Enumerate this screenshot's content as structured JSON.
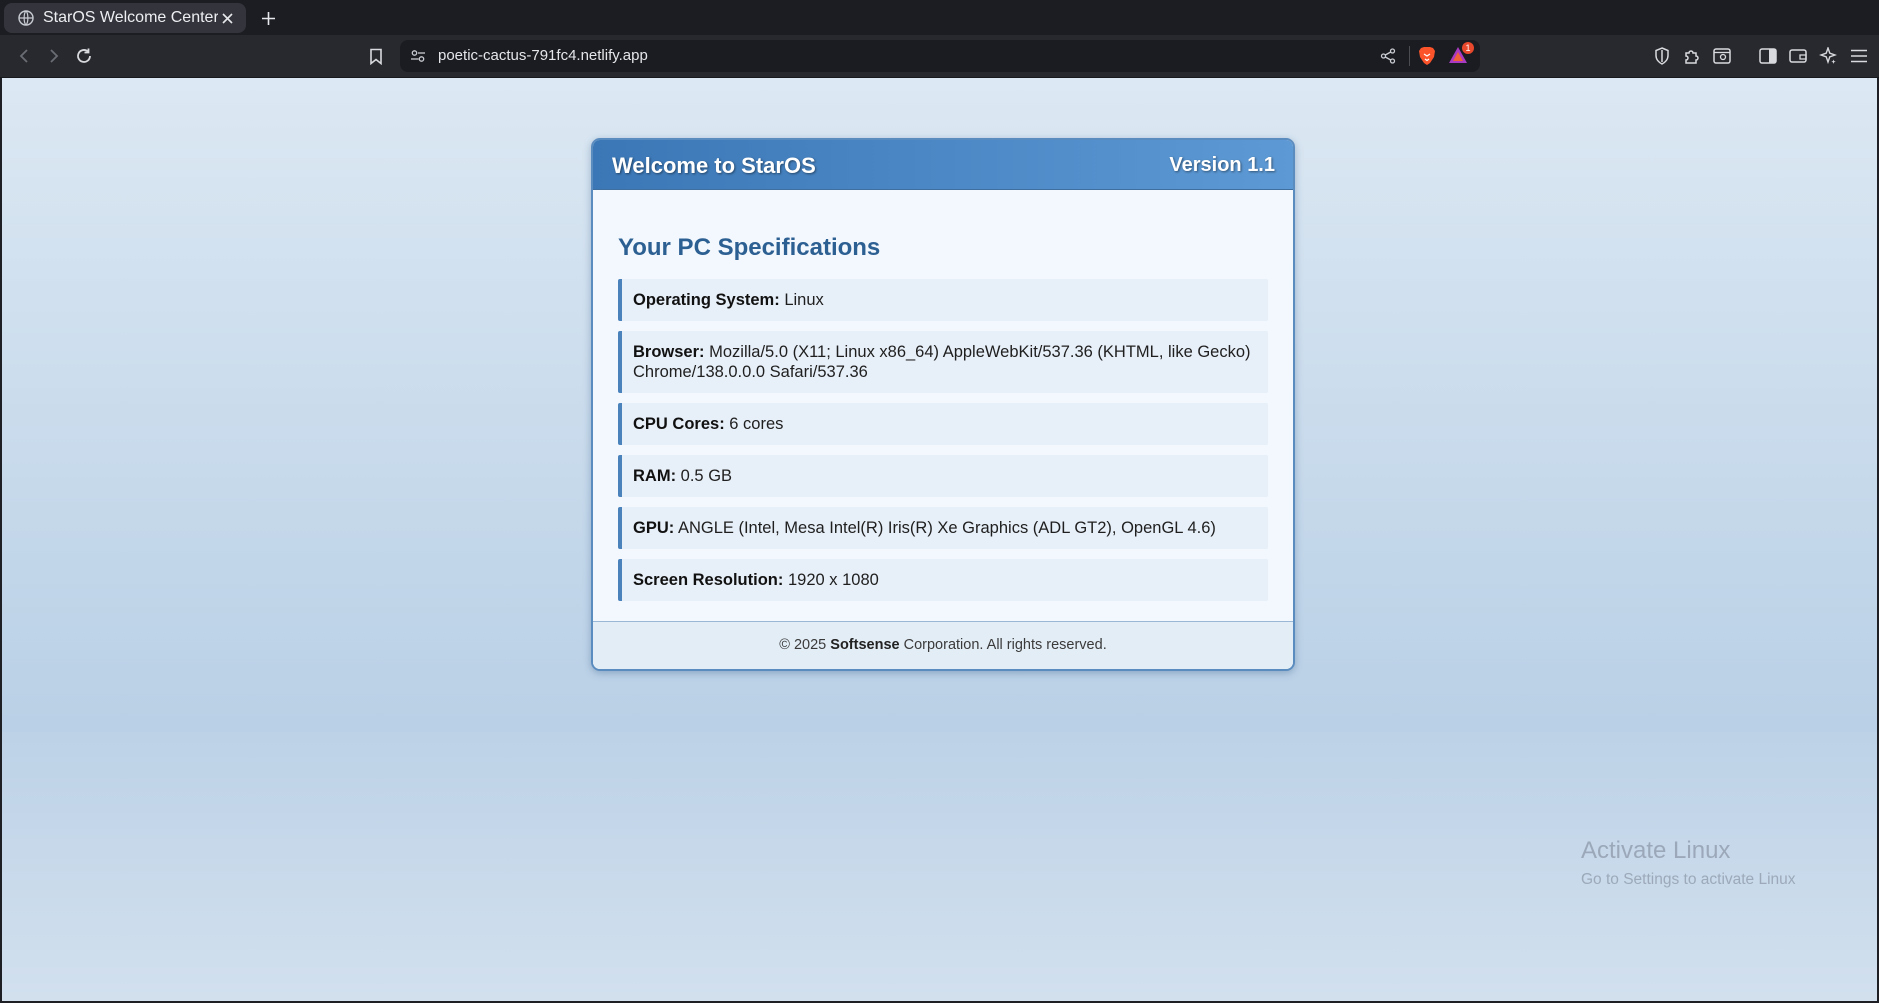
{
  "browser": {
    "tab_title": "StarOS Welcome Center",
    "url": "poetic-cactus-791fc4.netlify.app",
    "rewards_badge": "1"
  },
  "card": {
    "header_title": "Welcome to StarOS",
    "version": "Version 1.1",
    "section_title": "Your PC Specifications",
    "specs": [
      {
        "label": "Operating System:",
        "value": "Linux"
      },
      {
        "label": "Browser:",
        "value": "Mozilla/5.0 (X11; Linux x86_64) AppleWebKit/537.36 (KHTML, like Gecko) Chrome/138.0.0.0 Safari/537.36"
      },
      {
        "label": "CPU Cores:",
        "value": "6 cores"
      },
      {
        "label": "RAM:",
        "value": "0.5 GB"
      },
      {
        "label": "GPU:",
        "value": "ANGLE (Intel, Mesa Intel(R) Iris(R) Xe Graphics (ADL GT2), OpenGL 4.6)"
      },
      {
        "label": "Screen Resolution:",
        "value": "1920 x 1080"
      }
    ],
    "footer": {
      "prefix": "© 2025",
      "company": "Softsense",
      "suffix": "Corporation. All rights reserved."
    }
  },
  "watermark": {
    "line1": "Activate Linux",
    "line2": "Go to Settings to activate Linux"
  },
  "colors": {
    "header_start": "#3b77b6",
    "header_end": "#5d99d4",
    "title_blue": "#2c5f92",
    "accent_border": "#4a82bb",
    "brave_orange": "#fb542b"
  }
}
